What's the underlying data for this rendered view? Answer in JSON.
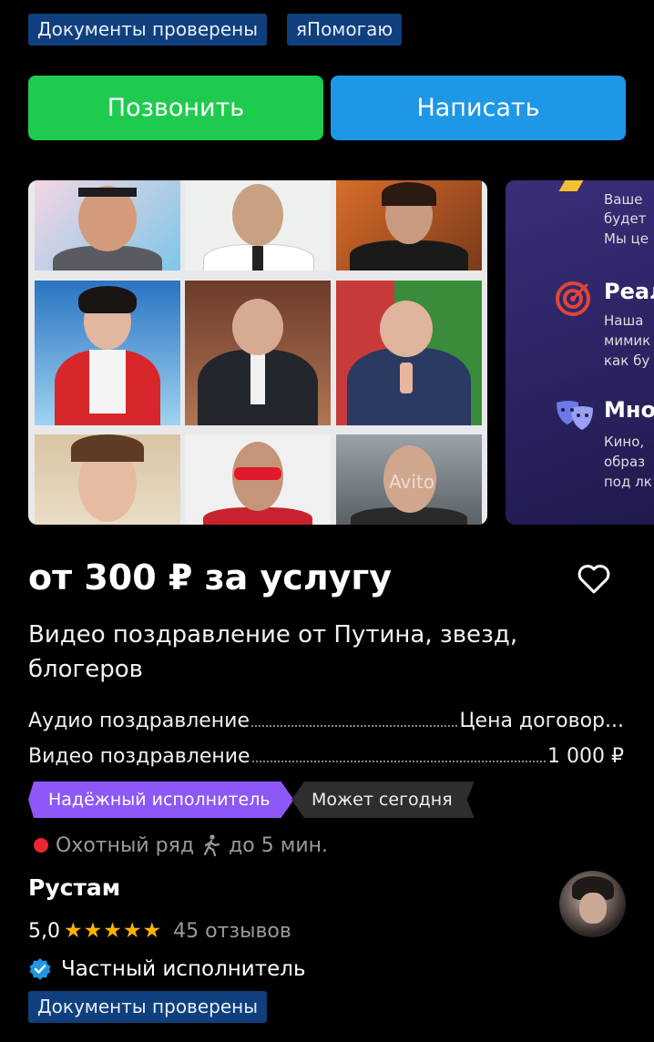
{
  "badges": {
    "docs": "Документы проверены",
    "help": "яПомогаю"
  },
  "actions": {
    "call": "Позвонить",
    "write": "Написать"
  },
  "gallery": {
    "watermark": "Avito"
  },
  "next_card": {
    "lines_top": [
      "Ваше ",
      "будет",
      "Мы це"
    ],
    "heading1": "Реал",
    "lines_mid": [
      "Наша",
      "мимик",
      "как бу"
    ],
    "heading2": "Мно",
    "lines_bot": [
      "Кино,",
      "образ",
      "под лк"
    ]
  },
  "listing": {
    "price": "от 300 ₽ за услугу",
    "title": "Видео поздравление от Путина, звезд, блогеров",
    "prices": [
      {
        "name": "Аудио поздравление",
        "value": "Цена договор..."
      },
      {
        "name": "Видео поздравление",
        "value": "1 000 ₽"
      }
    ],
    "tags": {
      "reliable": "Надёжный исполнитель",
      "today": "Может сегодня"
    },
    "location": {
      "metro": "Охотный ряд",
      "walk": "до 5 мин."
    }
  },
  "seller": {
    "name": "Рустам",
    "rating": "5,0",
    "stars": "★★★★★",
    "reviews": "45 отзывов",
    "type": "Частный исполнитель",
    "docs_badge": "Документы проверены"
  },
  "colors": {
    "green": "#1fcb4f",
    "blue": "#1e97e6",
    "purple": "#8e57f7",
    "badge": "#0f3f7d",
    "star": "#ffb400",
    "metro": "#e8262d"
  },
  "icons": [
    "heart-icon",
    "walking-person-icon",
    "verified-check-icon",
    "target-icon",
    "theater-masks-icon"
  ]
}
